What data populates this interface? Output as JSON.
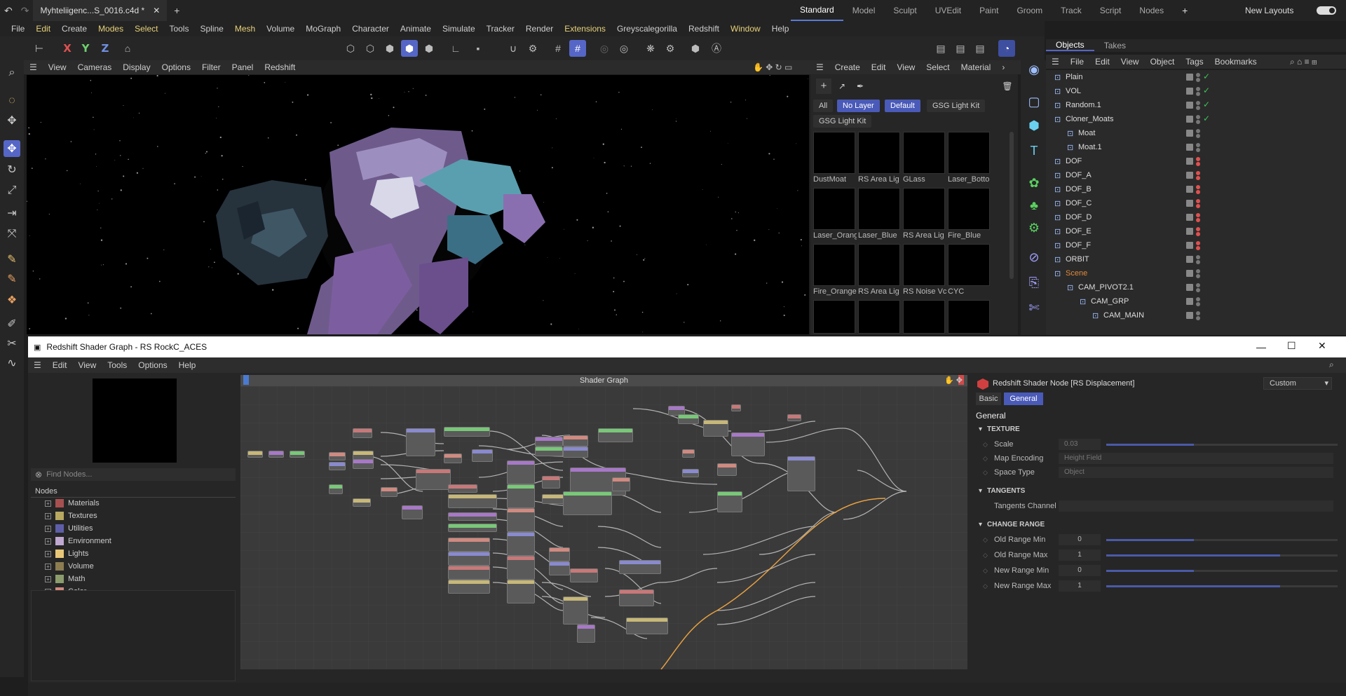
{
  "titlebar": {
    "doc_tab": "Myhteliigenc...S_0016.c4d *",
    "layouts": [
      "Standard",
      "Model",
      "Sculpt",
      "UVEdit",
      "Paint",
      "Groom",
      "Track",
      "Script",
      "Nodes"
    ],
    "active_layout": "Standard",
    "new_layouts": "New Layouts"
  },
  "menubar": [
    "File",
    "Edit",
    "Create",
    "Modes",
    "Select",
    "Tools",
    "Spline",
    "Mesh",
    "Volume",
    "MoGraph",
    "Character",
    "Animate",
    "Simulate",
    "Tracker",
    "Render",
    "Extensions",
    "Greyscalegorilla",
    "Redshift",
    "Window",
    "Help"
  ],
  "toolbar": {
    "axis_x": "X",
    "axis_y": "Y",
    "axis_z": "Z"
  },
  "viewport": {
    "menu": [
      "View",
      "Cameras",
      "Display",
      "Options",
      "Filter",
      "Panel",
      "Redshift"
    ]
  },
  "material_manager": {
    "menu": [
      "Create",
      "Edit",
      "View",
      "Select",
      "Material"
    ],
    "filters": [
      "All",
      "No Layer",
      "Default",
      "GSG Light Kit",
      "GSG Light Kit"
    ],
    "materials": [
      "DustMoat",
      "RS Area Lig",
      "GLass",
      "Laser_Botto",
      "Laser_Orang",
      "Laser_Blue",
      "RS Area Lig",
      "Fire_Blue",
      "Fire_Orange",
      "RS Area Lig",
      "RS Noise Vc",
      "CYC"
    ]
  },
  "object_manager": {
    "tabs": [
      "Objects",
      "Takes"
    ],
    "menu": [
      "File",
      "Edit",
      "View",
      "Object",
      "Tags",
      "Bookmarks"
    ],
    "objects": [
      {
        "name": "Plain",
        "indent": 0,
        "color": "#ddd",
        "status": "green"
      },
      {
        "name": "VOL",
        "indent": 0,
        "color": "#ddd",
        "status": "green"
      },
      {
        "name": "Random.1",
        "indent": 0,
        "color": "#ddd",
        "status": "green"
      },
      {
        "name": "Cloner_Moats",
        "indent": 0,
        "color": "#ddd",
        "status": "green"
      },
      {
        "name": "Moat",
        "indent": 1,
        "color": "#ddd",
        "status": "none"
      },
      {
        "name": "Moat.1",
        "indent": 1,
        "color": "#ddd",
        "status": "none"
      },
      {
        "name": "DOF",
        "indent": 0,
        "color": "#ddd",
        "status": "red"
      },
      {
        "name": "DOF_A",
        "indent": 0,
        "color": "#ddd",
        "status": "red"
      },
      {
        "name": "DOF_B",
        "indent": 0,
        "color": "#ddd",
        "status": "red"
      },
      {
        "name": "DOF_C",
        "indent": 0,
        "color": "#ddd",
        "status": "red"
      },
      {
        "name": "DOF_D",
        "indent": 0,
        "color": "#ddd",
        "status": "red"
      },
      {
        "name": "DOF_E",
        "indent": 0,
        "color": "#ddd",
        "status": "red"
      },
      {
        "name": "DOF_F",
        "indent": 0,
        "color": "#ddd",
        "status": "red"
      },
      {
        "name": "ORBIT",
        "indent": 0,
        "color": "#ddd",
        "status": "none"
      },
      {
        "name": "Scene",
        "indent": 0,
        "color": "#e08a3c",
        "status": "none"
      },
      {
        "name": "CAM_PIVOT2.1",
        "indent": 1,
        "color": "#ddd",
        "status": "none"
      },
      {
        "name": "CAM_GRP",
        "indent": 2,
        "color": "#ddd",
        "status": "none"
      },
      {
        "name": "CAM_MAIN",
        "indent": 3,
        "color": "#ddd",
        "status": "none"
      }
    ]
  },
  "shader_graph": {
    "window_title": "Redshift Shader Graph - RS RockC_ACES",
    "menu": [
      "Edit",
      "View",
      "Tools",
      "Options",
      "Help"
    ],
    "find_placeholder": "Find Nodes...",
    "nodes_header": "Nodes",
    "categories": [
      {
        "label": "Materials",
        "color": "#a85050"
      },
      {
        "label": "Textures",
        "color": "#b8a860"
      },
      {
        "label": "Utilities",
        "color": "#5e5ea8"
      },
      {
        "label": "Environment",
        "color": "#c0a8d0"
      },
      {
        "label": "Lights",
        "color": "#e8c878"
      },
      {
        "label": "Volume",
        "color": "#8c7c50"
      },
      {
        "label": "Math",
        "color": "#8c9c6c"
      },
      {
        "label": "Color",
        "color": "#d08a80"
      }
    ],
    "graph_title": "Shader Graph",
    "inspector": {
      "node_title": "Redshift Shader Node [RS Displacement]",
      "preset": "Custom",
      "tab_basic": "Basic",
      "tab_general": "General",
      "section": "General",
      "texture_header": "TEXTURE",
      "scale_label": "Scale",
      "scale_value": "0.03",
      "scale_fill": 0.38,
      "map_encoding_label": "Map Encoding",
      "map_encoding_value": "Height Field",
      "space_type_label": "Space Type",
      "space_type_value": "Object",
      "tangents_header": "TANGENTS",
      "tangents_channel_label": "Tangents Channel",
      "change_range_header": "CHANGE RANGE",
      "old_min_label": "Old Range Min",
      "old_min_value": "0",
      "old_min_fill": 0.38,
      "old_max_label": "Old Range Max",
      "old_max_value": "1",
      "old_max_fill": 0.75,
      "new_min_label": "New Range Min",
      "new_min_value": "0",
      "new_min_fill": 0.38,
      "new_max_label": "New Range Max",
      "new_max_value": "1",
      "new_max_fill": 0.75
    }
  },
  "colors": {
    "accent": "#5566c7",
    "brand_blue": "#4a5ab8",
    "status_green": "#3ec45a",
    "status_red": "#e05050"
  }
}
